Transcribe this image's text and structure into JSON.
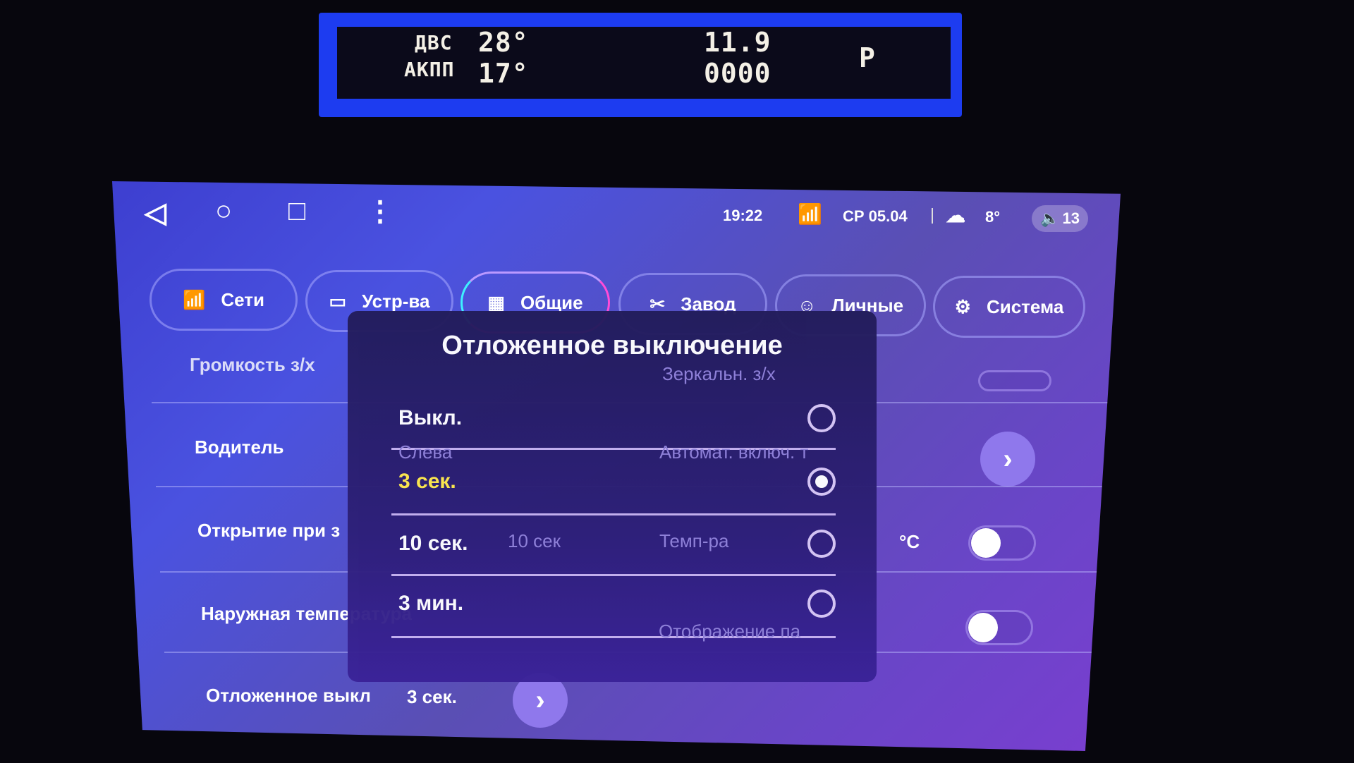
{
  "dashboard": {
    "engine_label": "ДВС",
    "engine_temp": "28°",
    "gearbox_label": "АКПП",
    "gearbox_temp": "17°",
    "voltage": "11.9",
    "odometer": "0000",
    "gear": "P"
  },
  "statusbar": {
    "time": "19:22",
    "date": "СР 05.04",
    "weather_temp": "8°",
    "volume": "13",
    "icons": [
      "wifi-icon",
      "cloud-icon",
      "volume-icon"
    ]
  },
  "navbar": {
    "icons": [
      "back-icon",
      "home-icon",
      "recents-icon",
      "menu-icon"
    ]
  },
  "tabs": [
    {
      "label": "Сети",
      "icon": "wifi-icon"
    },
    {
      "label": "Устр-ва",
      "icon": "device-icon"
    },
    {
      "label": "Общие",
      "icon": "grid-icon",
      "active": true
    },
    {
      "label": "Завод",
      "icon": "tools-icon"
    },
    {
      "label": "Личные",
      "icon": "person-icon"
    },
    {
      "label": "Система",
      "icon": "gear-icon"
    }
  ],
  "settings": {
    "rows": [
      {
        "label": "Громкость з/х",
        "right_label": "Зеркальн. з/х"
      },
      {
        "label": "Водитель",
        "value": "Слева",
        "right_label": "Автомат. включ. т"
      },
      {
        "label": "Открытие при з",
        "value": "10 сек",
        "right_label": "Темп-ра",
        "unit": "°C"
      },
      {
        "label": "Наружная температура",
        "right_label": "Отображение па"
      },
      {
        "label": "Отложенное выкл",
        "value": "3 сек."
      }
    ]
  },
  "dialog": {
    "title": "Отложенное выключение",
    "options": [
      {
        "label": "Выкл.",
        "selected": false
      },
      {
        "label": "3 сек.",
        "selected": true
      },
      {
        "label": "10 сек.",
        "selected": false
      },
      {
        "label": "3 мин.",
        "selected": false
      }
    ],
    "selected_color": "#ffe94a"
  }
}
